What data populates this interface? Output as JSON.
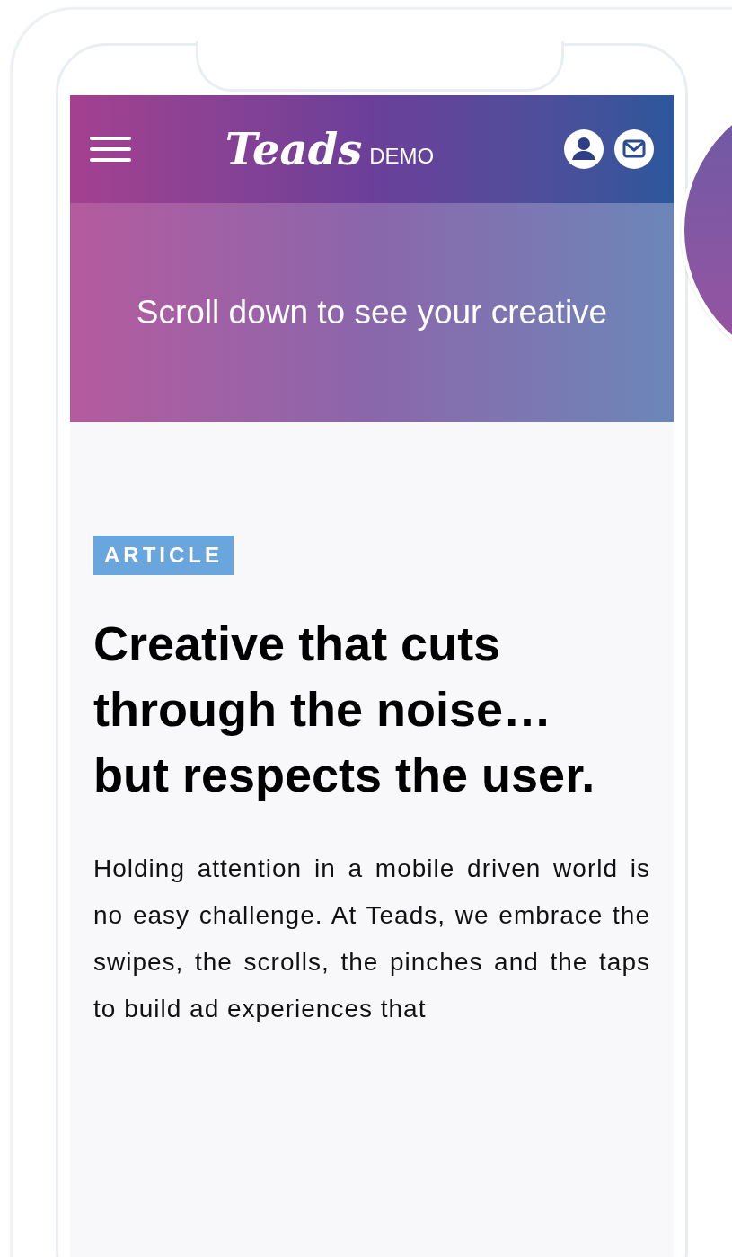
{
  "header": {
    "logo": "Teads",
    "logo_suffix": "DEMO"
  },
  "hero": {
    "text": "Scroll down to see your creative"
  },
  "article": {
    "tag": "ARTICLE",
    "title": "Creative that cuts through the noise… but respects the user.",
    "body": "Holding attention in a mobile driven world is no easy challenge. At Teads, we embrace the swipes, the scrolls, the pinches and the taps to build ad experiences that"
  }
}
